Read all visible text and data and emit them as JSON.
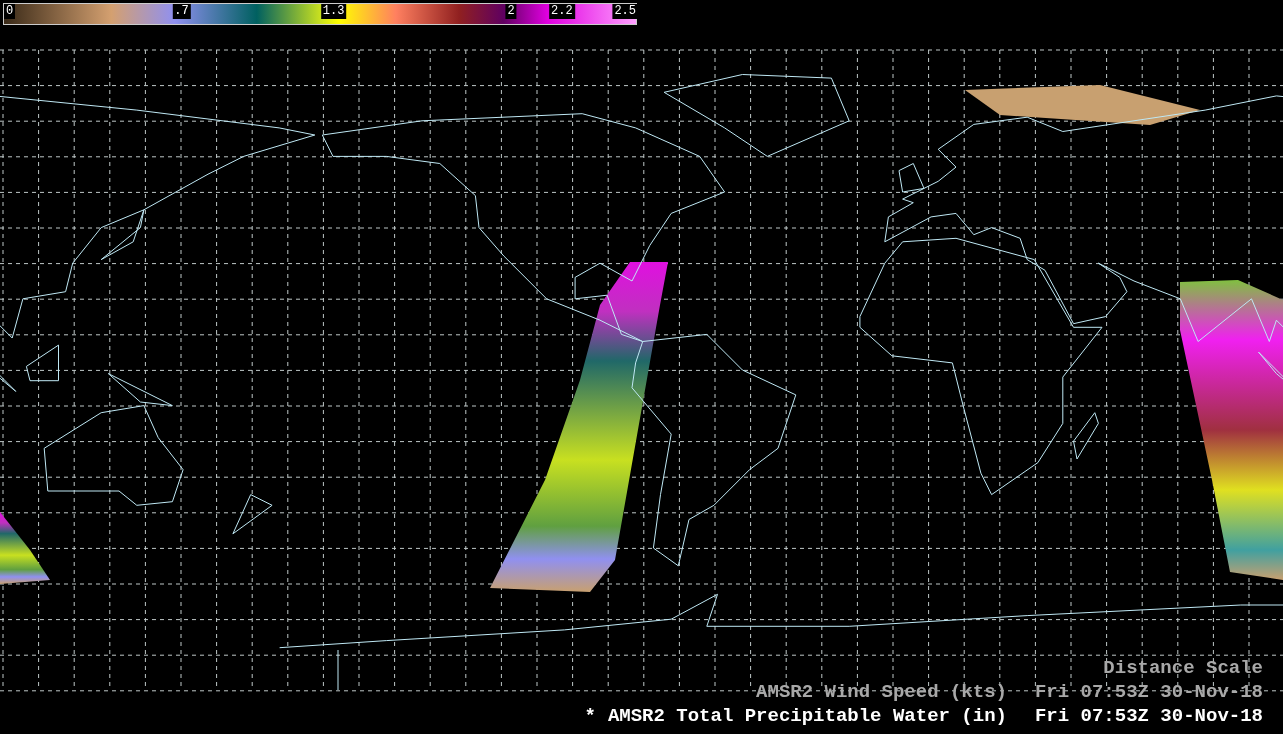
{
  "colorbar": {
    "ticks": [
      "0",
      ".7",
      "1.3",
      "2",
      "2.2",
      "2.5"
    ]
  },
  "distance_scale": "Distance Scale",
  "layers": [
    {
      "name": "AMSR2 Wind Speed (kts)",
      "time": "Fri 07:53Z 30-Nov-18",
      "selected": false
    },
    {
      "marker": "*",
      "name": "AMSR2 Total Precipitable Water (in)",
      "time": "Fri 07:53Z 30-Nov-18",
      "selected": true
    }
  ]
}
